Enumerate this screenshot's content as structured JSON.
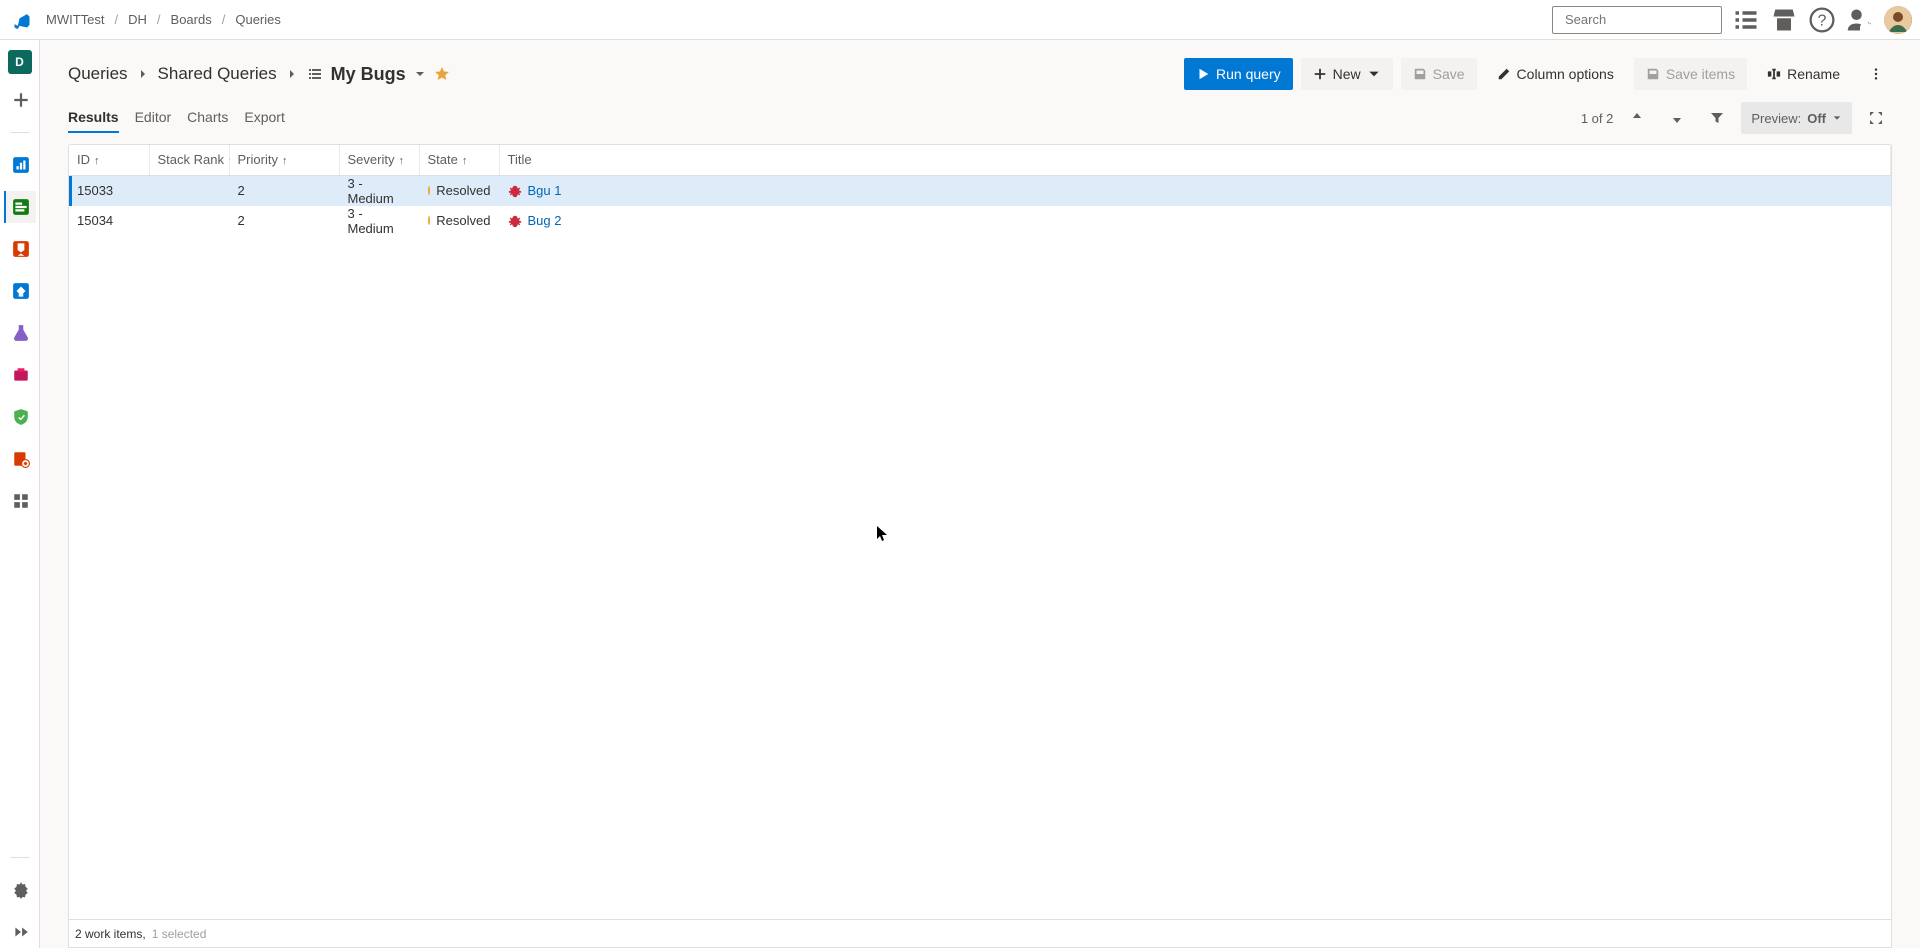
{
  "breadcrumbs": [
    "MWITTest",
    "DH",
    "Boards",
    "Queries"
  ],
  "search": {
    "placeholder": "Search"
  },
  "topbar_icons": [
    "tasks-icon",
    "shop-icon",
    "help-icon",
    "settings-icon"
  ],
  "project_initial": "D",
  "page": {
    "crumb1": "Queries",
    "crumb2": "Shared Queries",
    "title": "My Bugs"
  },
  "actions": {
    "run": "Run query",
    "new": "New",
    "save": "Save",
    "columns": "Column options",
    "save_items": "Save items",
    "rename": "Rename"
  },
  "tabs": [
    "Results",
    "Editor",
    "Charts",
    "Export"
  ],
  "tabs_active_index": 0,
  "tools": {
    "counter": "1 of 2",
    "preview_label": "Preview:",
    "preview_value": "Off"
  },
  "columns": {
    "id": "ID",
    "stack": "Stack Rank",
    "priority": "Priority",
    "severity": "Severity",
    "state": "State",
    "title": "Title"
  },
  "rows": [
    {
      "id": "15033",
      "stack": "",
      "priority": "2",
      "severity": "3 - Medium",
      "state": "Resolved",
      "title": "Bgu 1",
      "selected": true
    },
    {
      "id": "15034",
      "stack": "",
      "priority": "2",
      "severity": "3 - Medium",
      "state": "Resolved",
      "title": "Bug 2",
      "selected": false
    }
  ],
  "status": {
    "items": "2 work items,",
    "selected": "1 selected"
  }
}
